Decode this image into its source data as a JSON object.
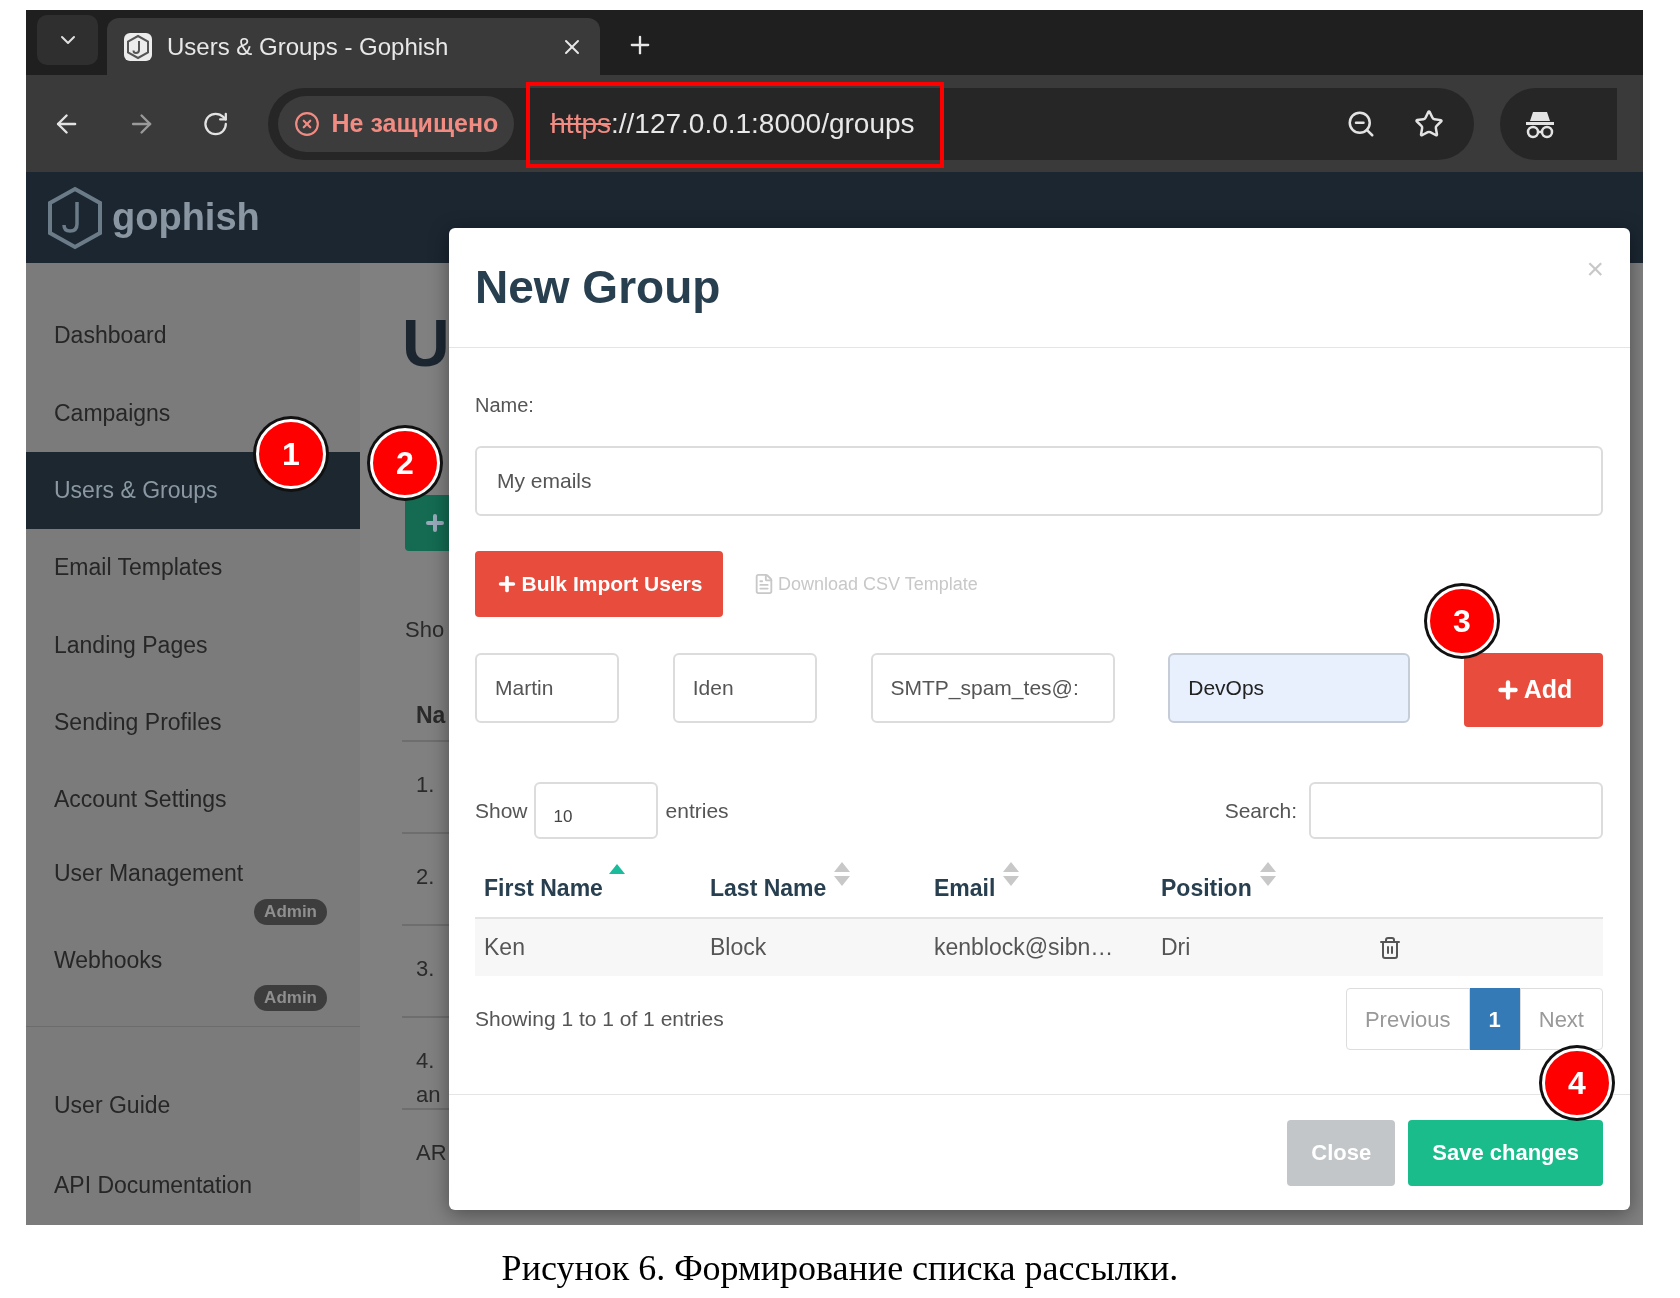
{
  "browser": {
    "tab_title": "Users & Groups - Gophish",
    "security_label": "Не защищено",
    "url_scheme": "https",
    "url_rest": "://127.0.0.1:8000/groups"
  },
  "app": {
    "brand": "gophish",
    "sidebar": [
      {
        "label": "Dashboard",
        "selected": false
      },
      {
        "label": "Campaigns",
        "selected": false
      },
      {
        "label": "Users & Groups",
        "selected": true
      },
      {
        "label": "Email Templates",
        "selected": false
      },
      {
        "label": "Landing Pages",
        "selected": false
      },
      {
        "label": "Sending Profiles",
        "selected": false
      },
      {
        "label": "Account Settings",
        "selected": false
      },
      {
        "label": "User Management",
        "selected": false,
        "badge": "Admin"
      },
      {
        "label": "Webhooks",
        "selected": false,
        "badge": "Admin"
      }
    ],
    "sidebar_footer": [
      "User Guide",
      "API Documentation"
    ],
    "page_title": "U",
    "show_label": "Sho",
    "column_header": "Na",
    "rows": [
      [
        "1."
      ],
      [
        "2."
      ],
      [
        "3."
      ],
      [
        "4.",
        "an"
      ],
      [
        "AR"
      ]
    ]
  },
  "modal": {
    "title": "New Group",
    "close": "×",
    "name_label": "Name:",
    "name_value": "My emails",
    "bulk_button": "Bulk Import Users",
    "csv_link": "Download CSV Template",
    "new_user": [
      {
        "value": "Martin",
        "autofilled": false
      },
      {
        "value": "Iden",
        "autofilled": false
      },
      {
        "value": "SMTP_spam_tes@:",
        "autofilled": false
      },
      {
        "value": "DevOps",
        "autofilled": true
      }
    ],
    "add_button": "Add",
    "show_label": "Show",
    "page_length": "10",
    "entries_label": "entries",
    "search_label": "Search:",
    "columns": [
      {
        "label": "First Name",
        "sorted": true
      },
      {
        "label": "Last Name",
        "sorted": false
      },
      {
        "label": "Email",
        "sorted": false
      },
      {
        "label": "Position",
        "sorted": false
      }
    ],
    "rows": [
      {
        "cells": [
          "Ken",
          "Block",
          "kenblock@sibn…",
          "Dri"
        ]
      }
    ],
    "info": "Showing 1 to 1 of 1 entries",
    "pagination": [
      {
        "label": "Previous",
        "selected": false
      },
      {
        "label": "1",
        "selected": true
      },
      {
        "label": "Next",
        "selected": false
      }
    ],
    "buttons": [
      {
        "label": "Close",
        "kind": "secondary"
      },
      {
        "label": "Save changes",
        "kind": "primary"
      }
    ]
  },
  "annotations": [
    "1",
    "2",
    "3",
    "4"
  ],
  "caption": "Рисунок 6. Формирование списка рассылки."
}
